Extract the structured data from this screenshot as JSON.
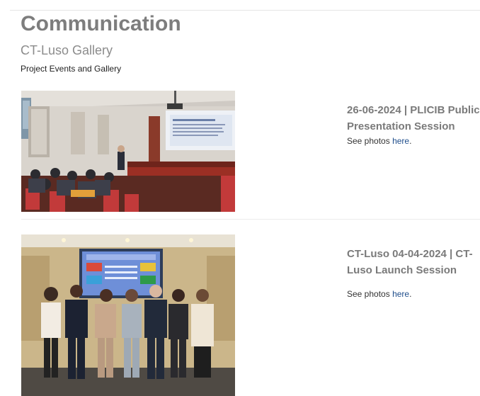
{
  "header": {
    "title": "Communication",
    "subtitle": "CT-Luso Gallery",
    "description": "Project Events and Gallery"
  },
  "events": [
    {
      "title_line1": "26-06-2024 | PLICIB Public",
      "title_line2": "Presentation Session",
      "see_prefix": "See photos ",
      "link_text": "here",
      "see_suffix": ".",
      "photo_icon": "conference-room-photo"
    },
    {
      "title_line1": "CT-Luso 04-04-2024 | CT-",
      "title_line2": "Luso Launch Session",
      "see_prefix": "See photos ",
      "link_text": "here",
      "see_suffix": ".",
      "photo_icon": "group-photo"
    }
  ],
  "colors": {
    "heading": "#7d7d7d",
    "link": "#1f4e8c"
  }
}
